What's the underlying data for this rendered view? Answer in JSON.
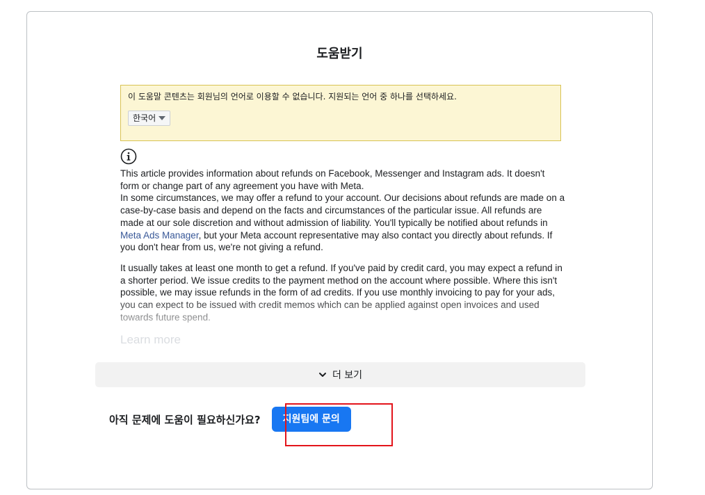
{
  "page": {
    "title": "도움받기"
  },
  "notice": {
    "text": "이 도움말 콘텐츠는 회원님의 언어로 이용할 수 없습니다. 지원되는 언어 중 하나를 선택하세요.",
    "language_selected": "한국어"
  },
  "article": {
    "p1_a": "This article provides information about refunds on Facebook, Messenger and Instagram ads. It doesn't form or change part of any agreement you have with Meta.",
    "p1_b": "In some circumstances, we may offer a refund to your account. Our decisions about refunds are made on a case-by-case basis and depend on the facts and circumstances of the particular issue. All refunds are made at our sole discretion and without admission of liability. You'll typically be notified about refunds in ",
    "p1_link": "Meta Ads Manager",
    "p1_c": ", but your Meta account representative may also contact you directly about refunds. If you don't hear from us, we're not giving a refund.",
    "p2": "It usually takes at least one month to get a refund. If you've paid by credit card, you may expect a refund in a shorter period. We issue credits to the payment method on the account where possible. Where this isn't possible, we may issue refunds in the form of ad credits. If you use monthly invoicing to pay for your ads, you can expect to be issued with credit memos which can be applied against open invoices and used towards future spend.",
    "learn_more": "Learn more"
  },
  "see_more": {
    "label": "더 보기"
  },
  "help": {
    "question": "아직 문제에 도움이 필요하신가요?",
    "contact_label": "지원팀에 문의"
  },
  "colors": {
    "accent": "#1877f2",
    "highlight_border": "#e3141b",
    "notice_bg": "#fcf6d4",
    "link": "#385898"
  },
  "icons": {
    "info": "info-circle-icon",
    "chevron": "chevron-down-icon",
    "caret": "caret-down-icon"
  }
}
